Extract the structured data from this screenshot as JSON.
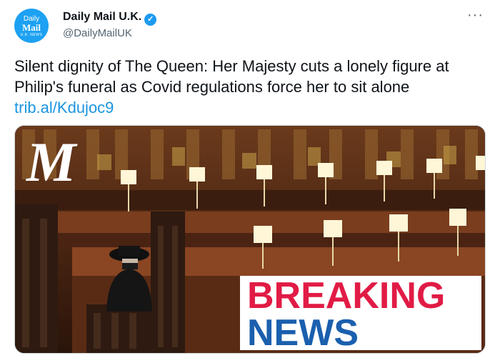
{
  "tweet": {
    "account_name": "Daily Mail U.K.",
    "handle": "@DailyMailUK",
    "more_label": "···",
    "avatar": {
      "line1": "Daily",
      "line2": "Mail",
      "line3": "U.K. NEWS"
    },
    "text": "Silent dignity of The Queen: Her Majesty cuts a lonely figure at Philip's funeral as Covid regulations force her to sit alone",
    "link": "trib.al/Kdujoc9"
  },
  "media": {
    "logo": "M",
    "banner_line1": "BREAKING",
    "banner_line2": "NEWS"
  },
  "colors": {
    "accent": "#1d9bf0",
    "link": "#1b95e0",
    "breaking_red": "#e11b45",
    "breaking_blue": "#1b5fae"
  }
}
